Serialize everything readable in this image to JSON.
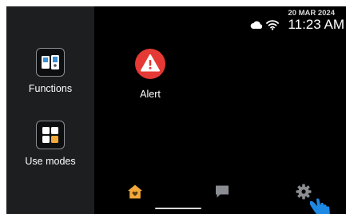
{
  "status_bar": {
    "date": "20 MAR 2024",
    "time": "11:23 AM",
    "icons": [
      "cloud-icon",
      "wifi-icon"
    ]
  },
  "sidebar": {
    "items": [
      {
        "label": "Functions",
        "icon": "intercom-functions-icon"
      },
      {
        "label": "Use modes",
        "icon": "grid-modes-icon"
      }
    ]
  },
  "apps": [
    {
      "label": "Alert",
      "icon": "alert-triangle-icon",
      "color": "#e53935"
    }
  ],
  "bottom_nav": {
    "items": [
      {
        "name": "home",
        "icon": "home-icon",
        "color": "#f2a83b",
        "active": true
      },
      {
        "name": "messages",
        "icon": "chat-icon",
        "color": "#8a8d92",
        "active": false
      },
      {
        "name": "settings",
        "icon": "gear-icon",
        "color": "#8a8d92",
        "active": false
      }
    ]
  },
  "colors": {
    "background": "#000000",
    "sidebar": "#1d1e20",
    "accent": "#f2a83b",
    "alert": "#e53935",
    "pointer": "#1e88e5"
  }
}
